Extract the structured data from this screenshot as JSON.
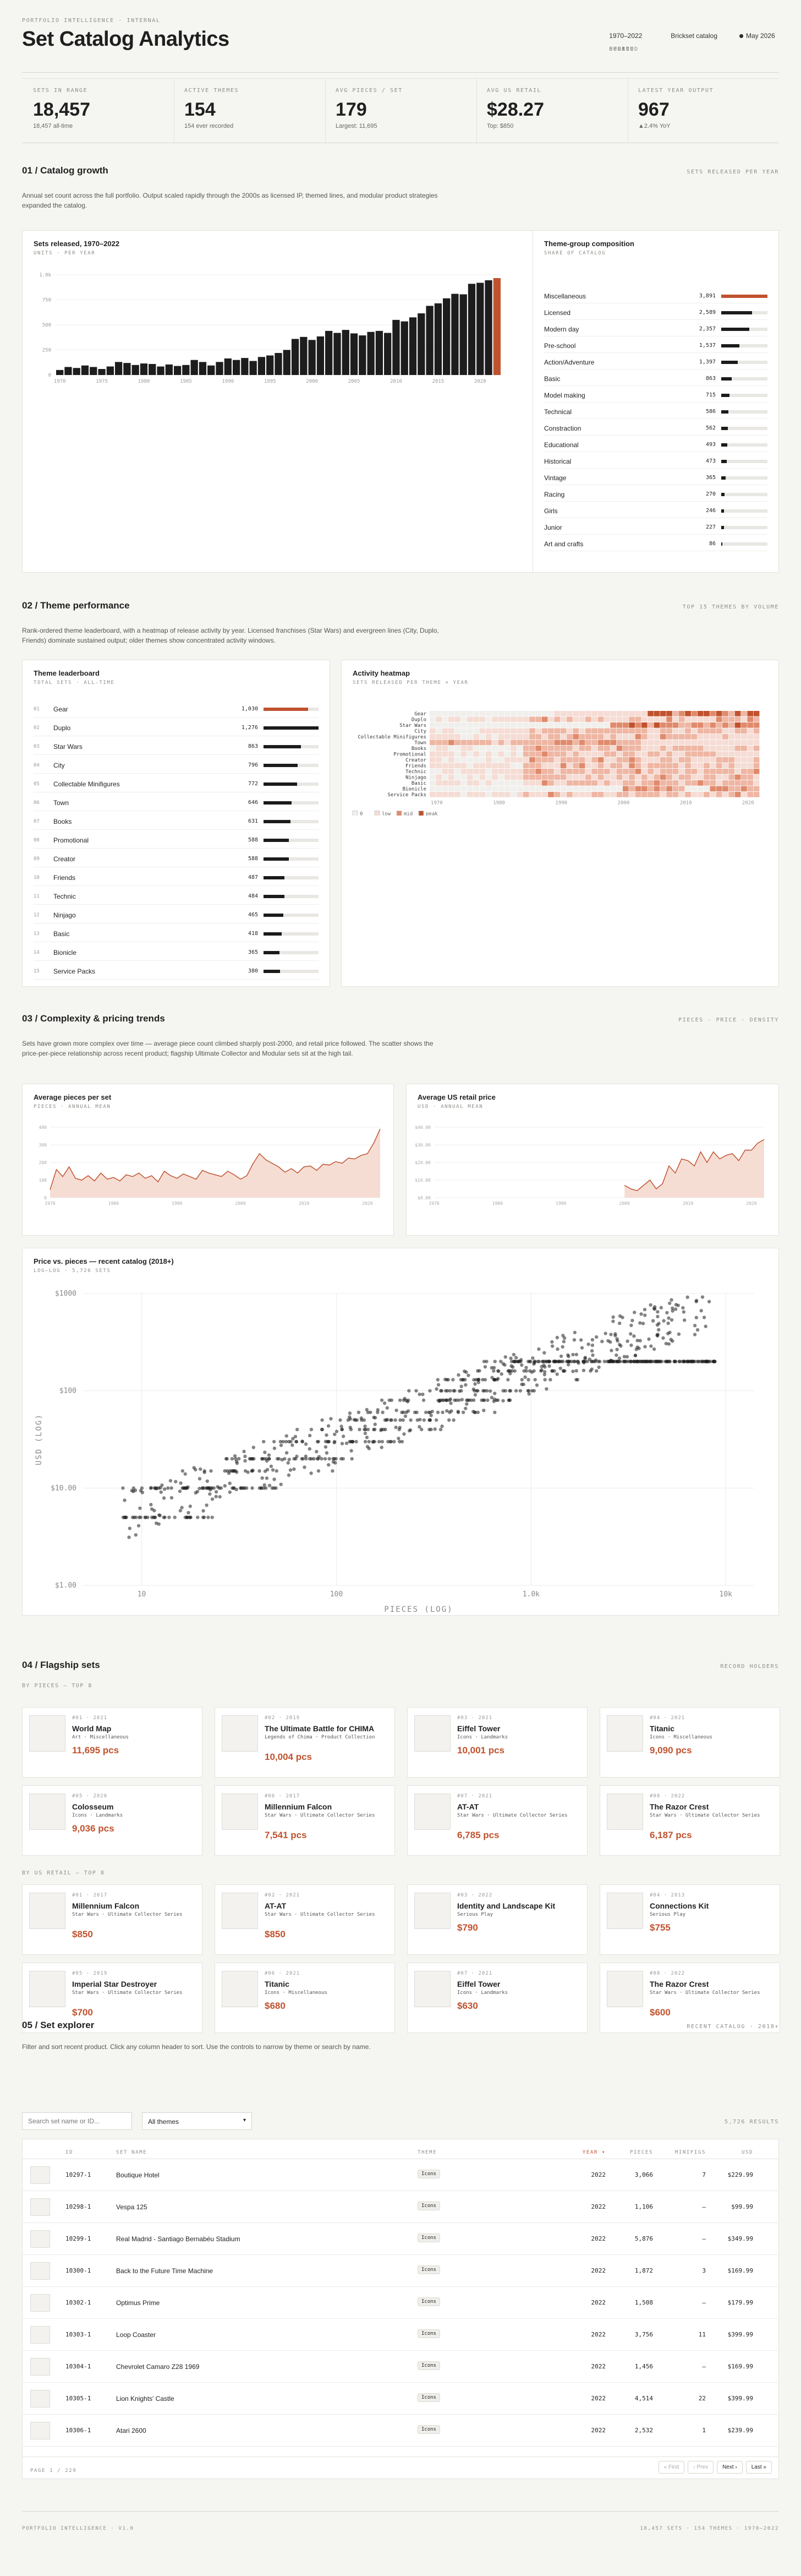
{
  "header": {
    "eyebrow": "PORTFOLIO INTELLIGENCE · INTERNAL",
    "title": "Set Catalog Analytics",
    "meta": [
      {
        "label": "PERIOD",
        "value": "1970–2022"
      },
      {
        "label": "SOURCE",
        "value": "Brickset catalog"
      },
      {
        "label": "UPDATED",
        "value": "May 2026"
      }
    ]
  },
  "kpis": [
    {
      "label": "SETS IN RANGE",
      "value": "18,457",
      "sub": "18,457 all-time"
    },
    {
      "label": "ACTIVE THEMES",
      "value": "154",
      "sub": "154 ever recorded"
    },
    {
      "label": "AVG PIECES / SET",
      "value": "179",
      "sub": "Largest: 11,695"
    },
    {
      "label": "AVG US RETAIL",
      "value": "$28.27",
      "sub": "Top: $850"
    },
    {
      "label": "LATEST YEAR OUTPUT",
      "value": "967",
      "sub": "▲2.4% YoY"
    }
  ],
  "s1": {
    "title": "01 / Catalog growth",
    "tag": "SETS RELEASED PER YEAR",
    "intro": "Annual set count across the full portfolio. Output scaled rapidly through the 2000s as licensed IP, themed lines, and modular product strategies expanded the catalog.",
    "bar_title": "Sets released, 1970–2022",
    "bar_sub": "UNITS · PER YEAR",
    "comp_title": "Theme-group composition",
    "comp_sub": "SHARE OF CATALOG",
    "groups": [
      {
        "name": "Miscellaneous",
        "value": "3,891",
        "n": 3891
      },
      {
        "name": "Licensed",
        "value": "2,589",
        "n": 2589
      },
      {
        "name": "Modern day",
        "value": "2,357",
        "n": 2357
      },
      {
        "name": "Pre-school",
        "value": "1,537",
        "n": 1537
      },
      {
        "name": "Action/Adventure",
        "value": "1,397",
        "n": 1397
      },
      {
        "name": "Basic",
        "value": "863",
        "n": 863
      },
      {
        "name": "Model making",
        "value": "715",
        "n": 715
      },
      {
        "name": "Technical",
        "value": "586",
        "n": 586
      },
      {
        "name": "Constraction",
        "value": "562",
        "n": 562
      },
      {
        "name": "Educational",
        "value": "493",
        "n": 493
      },
      {
        "name": "Historical",
        "value": "473",
        "n": 473
      },
      {
        "name": "Vintage",
        "value": "365",
        "n": 365
      },
      {
        "name": "Racing",
        "value": "270",
        "n": 270
      },
      {
        "name": "Girls",
        "value": "246",
        "n": 246
      },
      {
        "name": "Junior",
        "value": "227",
        "n": 227
      },
      {
        "name": "Art and crafts",
        "value": "86",
        "n": 86
      }
    ]
  },
  "s2": {
    "title": "02 / Theme performance",
    "tag": "TOP 15 THEMES BY VOLUME",
    "intro": "Rank-ordered theme leaderboard, with a heatmap of release activity by year. Licensed franchises (Star Wars) and evergreen lines (City, Duplo, Friends) dominate sustained output; older themes show concentrated activity windows.",
    "lb_title": "Theme leaderboard",
    "lb_sub": "TOTAL SETS · ALL-TIME",
    "themes": [
      {
        "rank": "01",
        "name": "Gear",
        "value": "1,030",
        "n": 1030
      },
      {
        "rank": "02",
        "name": "Duplo",
        "value": "1,276",
        "n": 1276
      },
      {
        "rank": "03",
        "name": "Star Wars",
        "value": "863",
        "n": 863
      },
      {
        "rank": "04",
        "name": "City",
        "value": "796",
        "n": 796
      },
      {
        "rank": "05",
        "name": "Collectable Minifigures",
        "value": "772",
        "n": 772
      },
      {
        "rank": "06",
        "name": "Town",
        "value": "646",
        "n": 646
      },
      {
        "rank": "07",
        "name": "Books",
        "value": "631",
        "n": 631
      },
      {
        "rank": "08",
        "name": "Promotional",
        "value": "588",
        "n": 588
      },
      {
        "rank": "09",
        "name": "Creator",
        "value": "588",
        "n": 588
      },
      {
        "rank": "10",
        "name": "Friends",
        "value": "487",
        "n": 487
      },
      {
        "rank": "11",
        "name": "Technic",
        "value": "484",
        "n": 484
      },
      {
        "rank": "12",
        "name": "Ninjago",
        "value": "465",
        "n": 465
      },
      {
        "rank": "13",
        "name": "Basic",
        "value": "418",
        "n": 418
      },
      {
        "rank": "14",
        "name": "Bionicle",
        "value": "365",
        "n": 365
      },
      {
        "rank": "15",
        "name": "Service Packs",
        "value": "380",
        "n": 380
      }
    ],
    "hm_title": "Activity heatmap",
    "hm_sub": "SETS RELEASED PER THEME × YEAR",
    "hm_rows": [
      "Gear",
      "Duplo",
      "Star Wars",
      "City",
      "Collectable Minifigures",
      "Town",
      "Books",
      "Promotional",
      "Creator",
      "Friends",
      "Technic",
      "Ninjago",
      "Basic",
      "Bionicle",
      "Service Packs"
    ],
    "hm_years": [
      "1970",
      "1980",
      "1990",
      "2000",
      "2010",
      "2020"
    ],
    "hm_legend": [
      "0",
      "low",
      "mid",
      "peak"
    ]
  },
  "s3": {
    "title": "03 / Complexity & pricing trends",
    "tag": "PIECES · PRICE · DENSITY",
    "intro": "Sets have grown more complex over time — average piece count climbed sharply post-2000, and retail price followed. The scatter shows the price-per-piece relationship across recent product; flagship Ultimate Collector and Modular sets sit at the high tail.",
    "p_title": "Average pieces per set",
    "p_sub": "PIECES · ANNUAL MEAN",
    "r_title": "Average US retail price",
    "r_sub": "USD · ANNUAL MEAN",
    "sc_title": "Price vs. pieces — recent catalog (2018+)",
    "sc_sub": "LOG–LOG · 5,726 SETS",
    "sc_xlabel": "PIECES (LOG)",
    "sc_ylabel": "USD (LOG)"
  },
  "chart_data": [
    {
      "type": "bar",
      "title": "Sets released, 1970–2022",
      "x": [
        1970,
        1971,
        1972,
        1973,
        1974,
        1975,
        1976,
        1977,
        1978,
        1979,
        1980,
        1981,
        1982,
        1983,
        1984,
        1985,
        1986,
        1987,
        1988,
        1989,
        1990,
        1991,
        1992,
        1993,
        1994,
        1995,
        1996,
        1997,
        1998,
        1999,
        2000,
        2001,
        2002,
        2003,
        2004,
        2005,
        2006,
        2007,
        2008,
        2009,
        2010,
        2011,
        2012,
        2013,
        2014,
        2015,
        2016,
        2017,
        2018,
        2019,
        2020,
        2021,
        2022
      ],
      "values": [
        50,
        80,
        70,
        95,
        80,
        60,
        85,
        130,
        120,
        100,
        115,
        110,
        85,
        105,
        90,
        100,
        150,
        130,
        95,
        130,
        165,
        150,
        170,
        140,
        180,
        195,
        220,
        250,
        360,
        380,
        350,
        385,
        440,
        420,
        450,
        415,
        395,
        430,
        440,
        420,
        550,
        535,
        575,
        615,
        690,
        715,
        765,
        810,
        805,
        910,
        920,
        945,
        967
      ],
      "ylim": [
        0,
        1000
      ],
      "yticks": [
        "0",
        "250",
        "500",
        "750",
        "1.0k"
      ]
    },
    {
      "type": "area",
      "title": "Average pieces per set",
      "x": [
        1970,
        1971,
        1972,
        1973,
        1974,
        1975,
        1976,
        1977,
        1978,
        1979,
        1980,
        1981,
        1982,
        1983,
        1984,
        1985,
        1986,
        1987,
        1988,
        1989,
        1990,
        1991,
        1992,
        1993,
        1994,
        1995,
        1996,
        1997,
        1998,
        1999,
        2000,
        2001,
        2002,
        2003,
        2004,
        2005,
        2006,
        2007,
        2008,
        2009,
        2010,
        2011,
        2012,
        2013,
        2014,
        2015,
        2016,
        2017,
        2018,
        2019,
        2020,
        2021,
        2022
      ],
      "values": [
        45,
        160,
        120,
        175,
        110,
        100,
        125,
        95,
        140,
        105,
        115,
        95,
        130,
        120,
        140,
        110,
        125,
        90,
        150,
        125,
        110,
        135,
        120,
        105,
        155,
        140,
        130,
        120,
        150,
        130,
        105,
        125,
        195,
        250,
        215,
        195,
        175,
        145,
        165,
        140,
        175,
        180,
        155,
        190,
        185,
        205,
        195,
        225,
        220,
        240,
        250,
        310,
        390
      ],
      "ylim": [
        0,
        400
      ]
    },
    {
      "type": "line",
      "title": "Average US retail price",
      "x": [
        2000,
        2001,
        2002,
        2003,
        2004,
        2005,
        2006,
        2007,
        2008,
        2009,
        2010,
        2011,
        2012,
        2013,
        2014,
        2015,
        2016,
        2017,
        2018,
        2019,
        2020,
        2021,
        2022
      ],
      "values": [
        7,
        5,
        4,
        7,
        10,
        5,
        8,
        18,
        14,
        22,
        21,
        18,
        26,
        20,
        26,
        22,
        24,
        25,
        21,
        27,
        27,
        31,
        33
      ],
      "ylim": [
        0,
        40
      ]
    },
    {
      "type": "scatter",
      "title": "Price vs. pieces — recent catalog (2018+)",
      "xscale": "log",
      "yscale": "log",
      "xlim": [
        5,
        14000
      ],
      "ylim": [
        1,
        1000
      ],
      "xticks": [
        "10",
        "100",
        "1.0k",
        "10k"
      ],
      "yticks": [
        "$1.00",
        "$10.00",
        "$100",
        "$1000"
      ]
    }
  ],
  "s4": {
    "title": "04 / Flagship sets",
    "tag": "RECORD HOLDERS",
    "by_pieces": "BY PIECES — TOP 8",
    "by_price": "BY US RETAIL — TOP 8",
    "pieces": [
      {
        "rank": "#01 · 2021",
        "name": "World Map",
        "theme": "Art · Miscellaneous",
        "value": "11,695 pcs"
      },
      {
        "rank": "#02 · 2019",
        "name": "The Ultimate Battle for CHIMA",
        "theme": "Legends of Chima · Product Collection",
        "value": "10,004 pcs"
      },
      {
        "rank": "#03 · 2021",
        "name": "Eiffel Tower",
        "theme": "Icons · Landmarks",
        "value": "10,001 pcs"
      },
      {
        "rank": "#04 · 2021",
        "name": "Titanic",
        "theme": "Icons · Miscellaneous",
        "value": "9,090 pcs"
      },
      {
        "rank": "#05 · 2020",
        "name": "Colosseum",
        "theme": "Icons · Landmarks",
        "value": "9,036 pcs"
      },
      {
        "rank": "#06 · 2017",
        "name": "Millennium Falcon",
        "theme": "Star Wars · Ultimate Collector Series",
        "value": "7,541 pcs"
      },
      {
        "rank": "#07 · 2021",
        "name": "AT-AT",
        "theme": "Star Wars · Ultimate Collector Series",
        "value": "6,785 pcs"
      },
      {
        "rank": "#08 · 2022",
        "name": "The Razor Crest",
        "theme": "Star Wars · Ultimate Collector Series",
        "value": "6,187 pcs"
      }
    ],
    "prices": [
      {
        "rank": "#01 · 2017",
        "name": "Millennium Falcon",
        "theme": "Star Wars · Ultimate Collector Series",
        "value": "$850"
      },
      {
        "rank": "#02 · 2021",
        "name": "AT-AT",
        "theme": "Star Wars · Ultimate Collector Series",
        "value": "$850"
      },
      {
        "rank": "#03 · 2022",
        "name": "Identity and Landscape Kit",
        "theme": "Serious Play",
        "value": "$790"
      },
      {
        "rank": "#04 · 2013",
        "name": "Connections Kit",
        "theme": "Serious Play",
        "value": "$755"
      },
      {
        "rank": "#05 · 2019",
        "name": "Imperial Star Destroyer",
        "theme": "Star Wars · Ultimate Collector Series",
        "value": "$700"
      },
      {
        "rank": "#06 · 2021",
        "name": "Titanic",
        "theme": "Icons · Miscellaneous",
        "value": "$680"
      },
      {
        "rank": "#07 · 2021",
        "name": "Eiffel Tower",
        "theme": "Icons · Landmarks",
        "value": "$630"
      },
      {
        "rank": "#08 · 2022",
        "name": "The Razor Crest",
        "theme": "Star Wars · Ultimate Collector Series",
        "value": "$600"
      }
    ]
  },
  "s5": {
    "title": "05 / Set explorer",
    "tag": "RECENT CATALOG · 2018+",
    "intro": "Filter and sort recent product. Click any column header to sort. Use the controls to narrow by theme or search by name.",
    "search_placeholder": "Search set name or ID...",
    "theme_select": "All themes",
    "results": "5,726 RESULTS",
    "cols": {
      "id": "ID",
      "name": "SET NAME",
      "theme": "THEME",
      "year": "YEAR ▾",
      "pieces": "PIECES",
      "minifigs": "MINIFIGS",
      "usd": "USD"
    },
    "rows": [
      {
        "id": "10297-1",
        "name": "Boutique Hotel",
        "theme": "Icons",
        "year": "2022",
        "pieces": "3,066",
        "minifigs": "7",
        "usd": "$229.99"
      },
      {
        "id": "10298-1",
        "name": "Vespa 125",
        "theme": "Icons",
        "year": "2022",
        "pieces": "1,106",
        "minifigs": "—",
        "usd": "$99.99"
      },
      {
        "id": "10299-1",
        "name": "Real Madrid - Santiago Bernabéu Stadium",
        "theme": "Icons",
        "year": "2022",
        "pieces": "5,876",
        "minifigs": "—",
        "usd": "$349.99"
      },
      {
        "id": "10300-1",
        "name": "Back to the Future Time Machine",
        "theme": "Icons",
        "year": "2022",
        "pieces": "1,872",
        "minifigs": "3",
        "usd": "$169.99"
      },
      {
        "id": "10302-1",
        "name": "Optimus Prime",
        "theme": "Icons",
        "year": "2022",
        "pieces": "1,508",
        "minifigs": "—",
        "usd": "$179.99"
      },
      {
        "id": "10303-1",
        "name": "Loop Coaster",
        "theme": "Icons",
        "year": "2022",
        "pieces": "3,756",
        "minifigs": "11",
        "usd": "$399.99"
      },
      {
        "id": "10304-1",
        "name": "Chevrolet Camaro Z28 1969",
        "theme": "Icons",
        "year": "2022",
        "pieces": "1,456",
        "minifigs": "—",
        "usd": "$169.99"
      },
      {
        "id": "10305-1",
        "name": "Lion Knights' Castle",
        "theme": "Icons",
        "year": "2022",
        "pieces": "4,514",
        "minifigs": "22",
        "usd": "$399.99"
      },
      {
        "id": "10306-1",
        "name": "Atari 2600",
        "theme": "Icons",
        "year": "2022",
        "pieces": "2,532",
        "minifigs": "1",
        "usd": "$239.99"
      }
    ],
    "page": "PAGE 1 / 229",
    "first": "« First",
    "prev": "‹ Prev",
    "next": "Next ›",
    "last": "Last »"
  },
  "footer": {
    "left": "PORTFOLIO INTELLIGENCE · v1.0",
    "right": "18,457 SETS · 154 THEMES · 1970–2022"
  }
}
